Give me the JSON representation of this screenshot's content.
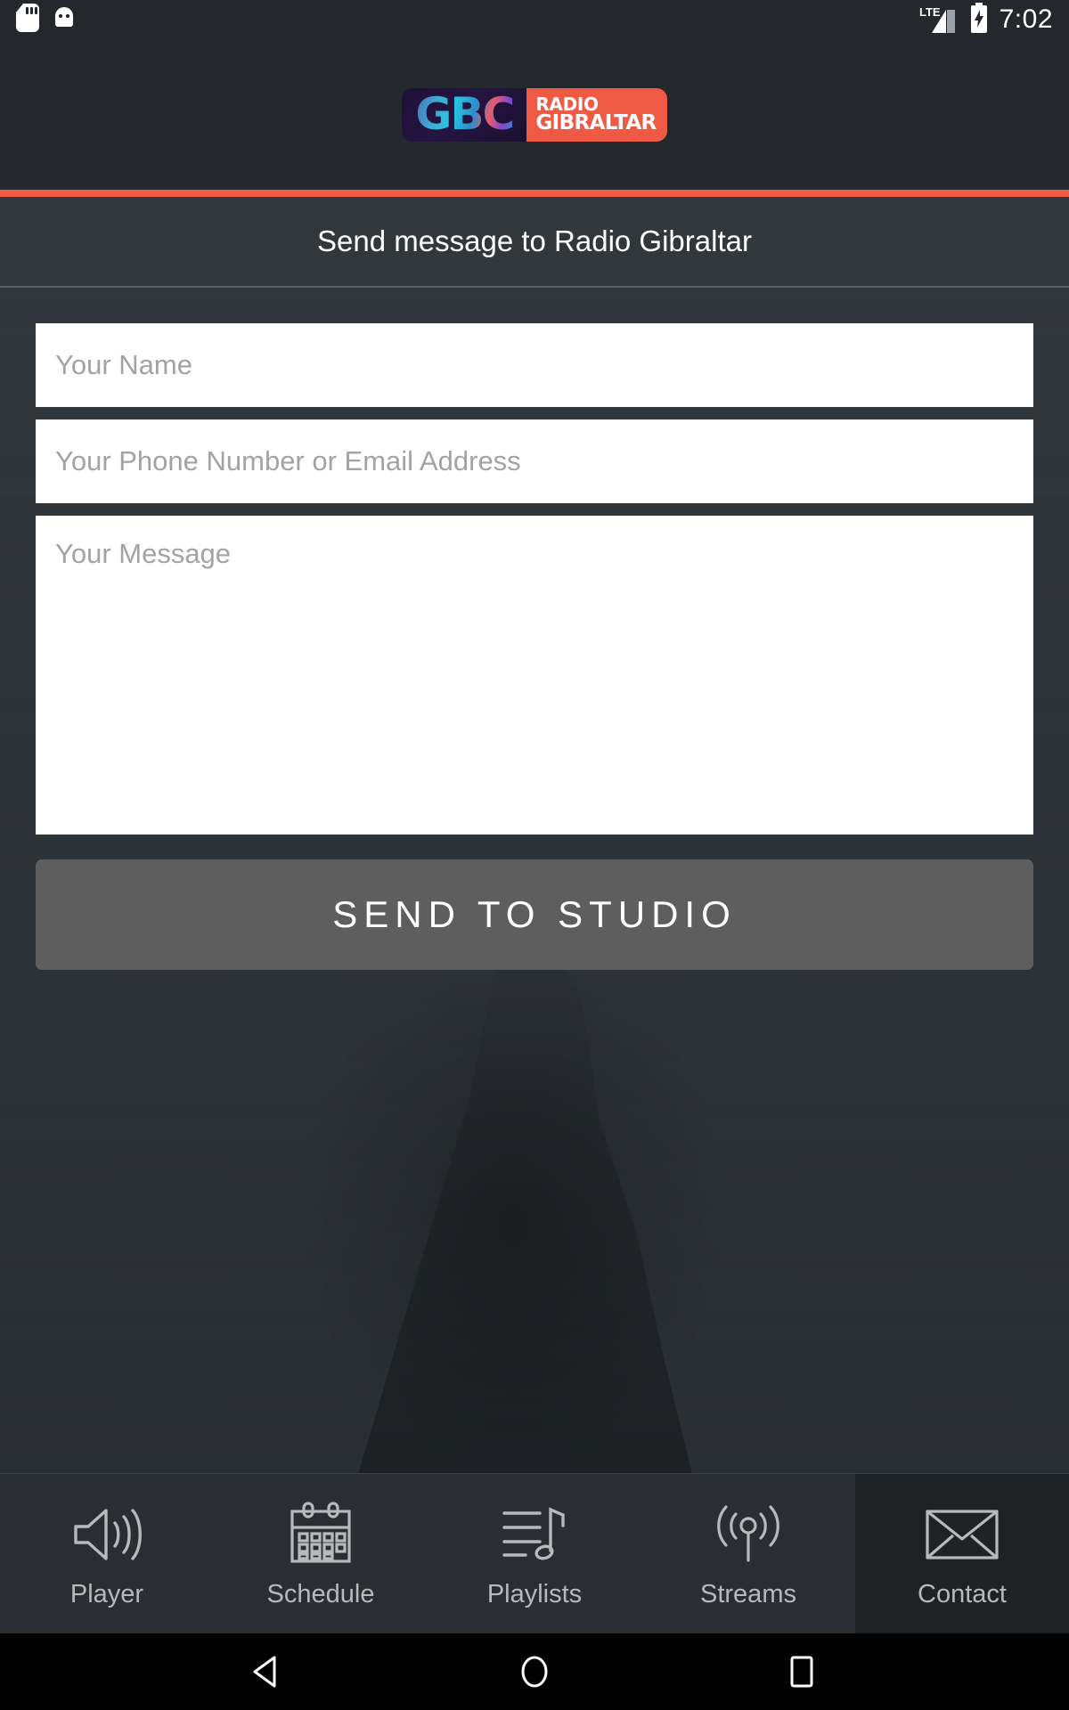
{
  "status_bar": {
    "left_icons": [
      "sd-card-icon",
      "android-robot-icon"
    ],
    "network_label": "LTE",
    "right_icons": [
      "signal-bars-icon",
      "battery-charging-icon"
    ],
    "clock": "7:02"
  },
  "brand": {
    "mark": "GBC",
    "name_line1": "RADIO",
    "name_line2": "GIBRALTAR",
    "mark_bg": "#1d1036",
    "name_bg": "#ef5a45"
  },
  "accent_color": "#ef5a45",
  "header": {
    "title": "Send message to Radio Gibraltar"
  },
  "form": {
    "name_placeholder": "Your Name",
    "name_value": "",
    "contact_placeholder": "Your Phone Number or Email Address",
    "contact_value": "",
    "message_placeholder": "Your Message",
    "message_value": "",
    "submit_label": "SEND TO STUDIO"
  },
  "tabs": [
    {
      "label": "Player",
      "icon": "speaker-volume-icon",
      "active": false
    },
    {
      "label": "Schedule",
      "icon": "calendar-icon",
      "active": false
    },
    {
      "label": "Playlists",
      "icon": "playlist-music-icon",
      "active": false
    },
    {
      "label": "Streams",
      "icon": "broadcast-antenna-icon",
      "active": false
    },
    {
      "label": "Contact",
      "icon": "envelope-icon",
      "active": true
    }
  ],
  "android_nav": {
    "back": "back-triangle-icon",
    "home": "home-circle-icon",
    "recents": "recents-square-icon"
  }
}
